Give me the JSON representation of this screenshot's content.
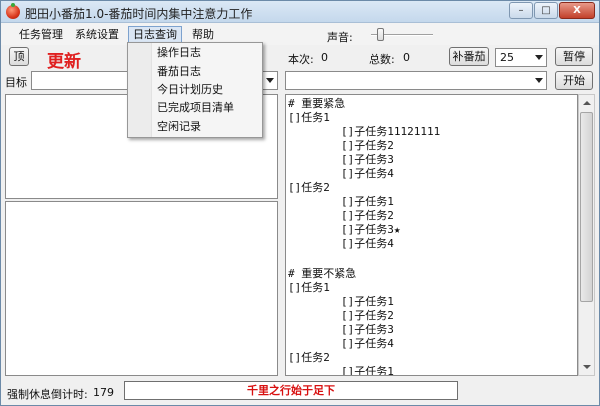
{
  "window": {
    "title": "肥田小番茄1.0-番茄时间内集中注意力工作",
    "minimize": "–",
    "maximize": "□",
    "close": "X"
  },
  "menu": {
    "items": [
      "任务管理",
      "系统设置",
      "日志查询",
      "帮助"
    ],
    "active_index": 2
  },
  "dropdown": {
    "items": [
      "操作日志",
      "番茄日志",
      "今日计划历史",
      "已完成项目清单",
      "空闲记录"
    ]
  },
  "sound": {
    "label": "声音:",
    "level_fraction": 0.1
  },
  "toolbar": {
    "top_button": "顶",
    "update_label": "更新",
    "this_time_label": "本次:",
    "this_time_value": "0",
    "total_label": "总数:",
    "total_value": "0",
    "add_tomato_button": "补番茄",
    "minutes_value": "25",
    "pause_button": "暂停",
    "start_button": "开始"
  },
  "goal": {
    "label": "目标",
    "value": ""
  },
  "task_list": {
    "lines": [
      "# 重要紧急",
      "[]任务1",
      "        []子任务11121111",
      "        []子任务2",
      "        []子任务3",
      "        []子任务4",
      "[]任务2",
      "        []子任务1",
      "        []子任务2",
      "        []子任务3★",
      "        []子任务4",
      "",
      "# 重要不紧急",
      "[]任务1",
      "        []子任务1",
      "        []子任务2",
      "        []子任务3",
      "        []子任务4",
      "[]任务2",
      "        []子任务1"
    ]
  },
  "status": {
    "rest_countdown_label": "强制休息倒计时:",
    "rest_countdown_value": "179",
    "motto": "千里之行始于足下"
  }
}
